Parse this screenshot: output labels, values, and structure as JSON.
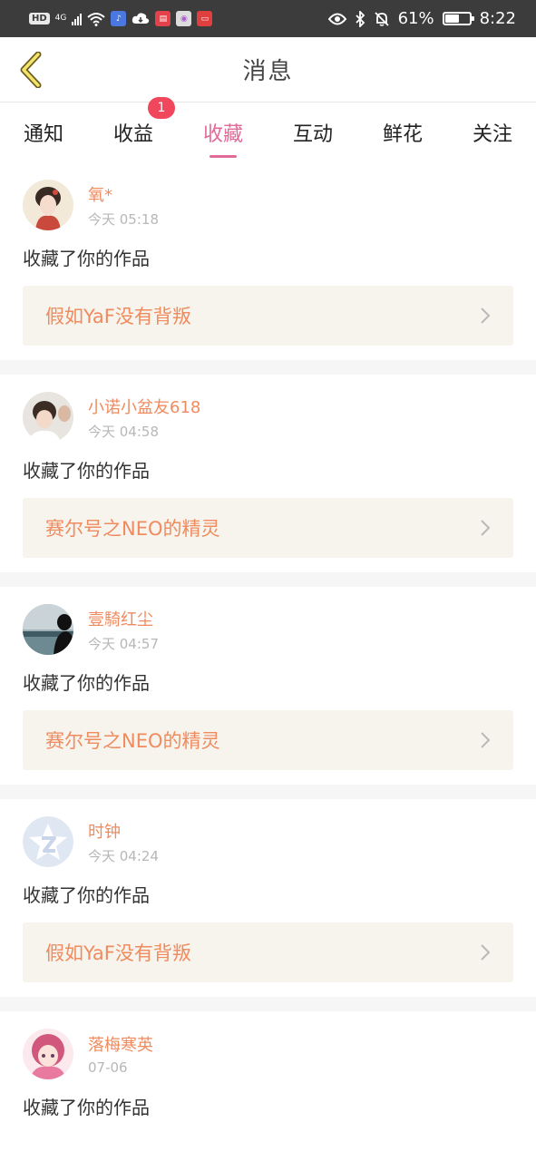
{
  "status_bar": {
    "hd": "HD",
    "network": "4G",
    "battery": "61%",
    "time": "8:22"
  },
  "header": {
    "title": "消息",
    "back_icon": "back-chevron-icon"
  },
  "tabs": [
    {
      "label": "通知",
      "active": false
    },
    {
      "label": "收益",
      "active": false,
      "badge": "1"
    },
    {
      "label": "收藏",
      "active": true
    },
    {
      "label": "互动",
      "active": false
    },
    {
      "label": "鲜花",
      "active": false
    },
    {
      "label": "关注",
      "active": false
    }
  ],
  "feed": [
    {
      "user": "氧*",
      "time": "今天 05:18",
      "action": "收藏了你的作品",
      "work": "假如YaF没有背叛"
    },
    {
      "user": "小诺小盆友618",
      "time": "今天 04:58",
      "action": "收藏了你的作品",
      "work": "赛尔号之NEO的精灵"
    },
    {
      "user": "壹騎红尘",
      "time": "今天 04:57",
      "action": "收藏了你的作品",
      "work": "赛尔号之NEO的精灵"
    },
    {
      "user": "时钟",
      "time": "今天 04:24",
      "action": "收藏了你的作品",
      "work": "假如YaF没有背叛"
    },
    {
      "user": "落梅寒英",
      "time": "07-06",
      "action": "收藏了你的作品",
      "work": ""
    }
  ],
  "colors": {
    "accent": "#e26a98",
    "username": "#ef8b5f",
    "badge": "#f1475c",
    "work_bg": "#f6f4ec"
  }
}
